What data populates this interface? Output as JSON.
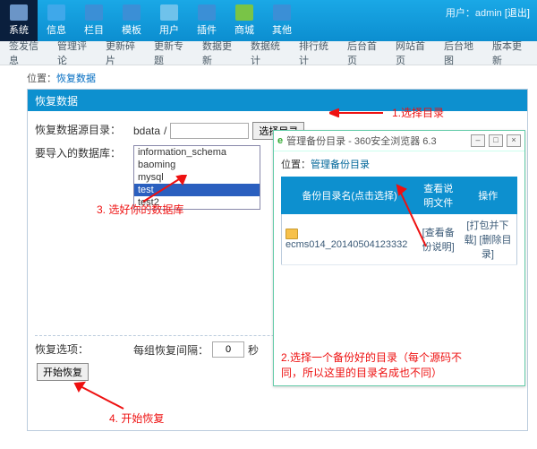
{
  "userline": {
    "prefix": "用户：",
    "name": "admin",
    "logout": "[退出]"
  },
  "menu": [
    {
      "label": "系统",
      "ico": "#6b95c7"
    },
    {
      "label": "信息",
      "ico": "#3fa8ea"
    },
    {
      "label": "栏目",
      "ico": "#3b8fd6"
    },
    {
      "label": "模板",
      "ico": "#3b8fd6"
    },
    {
      "label": "用户",
      "ico": "#6fc2eb"
    },
    {
      "label": "插件",
      "ico": "#3b8fd6"
    },
    {
      "label": "商城",
      "ico": "#79c447"
    },
    {
      "label": "其他",
      "ico": "#3b8fd6"
    }
  ],
  "subnav": [
    "签发信息",
    "管理评论",
    "更新碎片",
    "更新专题",
    "数据更新",
    "数据统计",
    "排行统计",
    "后台首页",
    "网站首页",
    "后台地图",
    "版本更新"
  ],
  "crumb": {
    "lbl": "位置：",
    "cur": "恢复数据"
  },
  "panel": {
    "title": "恢复数据"
  },
  "form": {
    "srcLabel": "恢复数据源目录：",
    "srcDir": "bdata",
    "srcSub": "",
    "pickBtn": "选择目录",
    "dbLabel": "要导入的数据库：",
    "dbList": [
      "information_schema",
      "baoming",
      "mysql",
      "test",
      "test2"
    ],
    "dbSelected": "test",
    "optLabel": "恢复选项：",
    "intervalLabel": "每组恢复间隔：",
    "intervalVal": "0",
    "sec": "秒",
    "startBtn": "开始恢复"
  },
  "annot": {
    "n1": "1.选择目录",
    "n3": "3. 选好你的数据库",
    "n4": "4. 开始恢复",
    "n2a": "2.选择一个备份好的目录（每个源码不",
    "n2b": "同，所以这里的目录名成也不同）"
  },
  "win": {
    "title": "管理备份目录 - 360安全浏览器 6.3",
    "crumbLbl": "位置：",
    "crumb": "管理备份目录",
    "th1": "备份目录名(点击选择)",
    "th2": "查看说明文件",
    "th3": "操作",
    "row": {
      "name": "ecms014_20140504123332",
      "view": "[查看备份说明]",
      "pack": "[打包并下载]",
      "del": "[删除目录]"
    }
  }
}
